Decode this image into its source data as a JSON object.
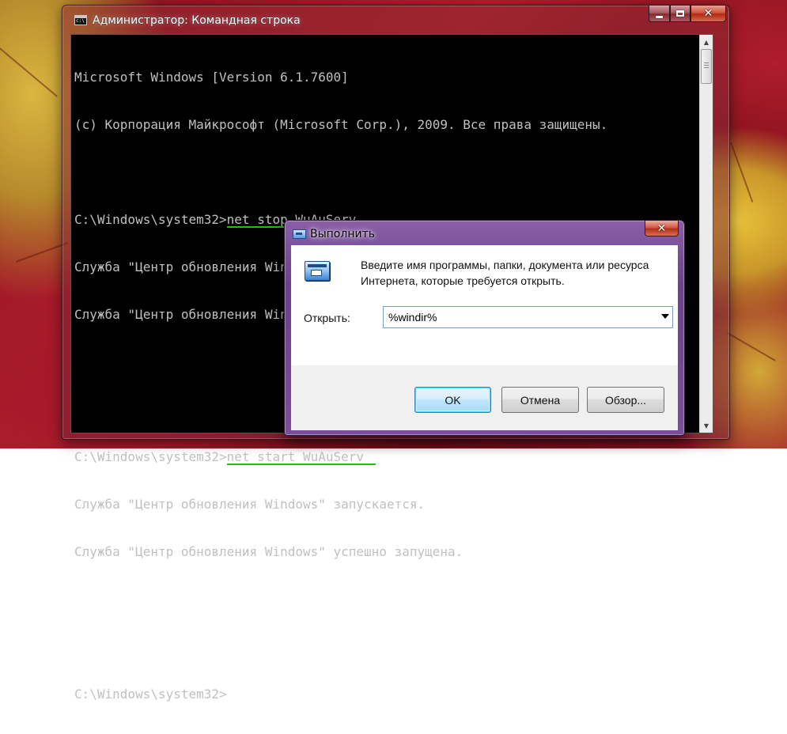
{
  "cmd": {
    "title": "Администратор: Командная строка",
    "lines": {
      "l1": "Microsoft Windows [Version 6.1.7600]",
      "l2": "(c) Корпорация Майкрософт (Microsoft Corp.), 2009. Все права защищены.",
      "prompt1": "C:\\Windows\\system32>",
      "cmd1": "net stop WuAuServ",
      "l4": "Служба \"Центр обновления Windows\" останавливается.",
      "l5": "Служба \"Центр обновления Windows\" успешно остановлена.",
      "prompt2": "C:\\Windows\\system32>",
      "cmd2": "net start WuAuServ",
      "l7": "Служба \"Центр обновления Windows\" запускается.",
      "l8": "Служба \"Центр обновления Windows\" успешно запущена.",
      "prompt3": "C:\\Windows\\system32>"
    },
    "caption": {
      "close_glyph": "✕"
    },
    "highlight_color": "#22c00c"
  },
  "run": {
    "title": "Выполнить",
    "description": "Введите имя программы, папки, документа или ресурса Интернета, которые требуется открыть.",
    "open_label": "Открыть:",
    "open_value": "%windir%",
    "ok_label": "OK",
    "cancel_label": "Отмена",
    "browse_label": "Обзор...",
    "close_glyph": "✕"
  },
  "icons": {
    "cmd_window_icon": "console-icon",
    "run_window_icon": "run-icon"
  }
}
